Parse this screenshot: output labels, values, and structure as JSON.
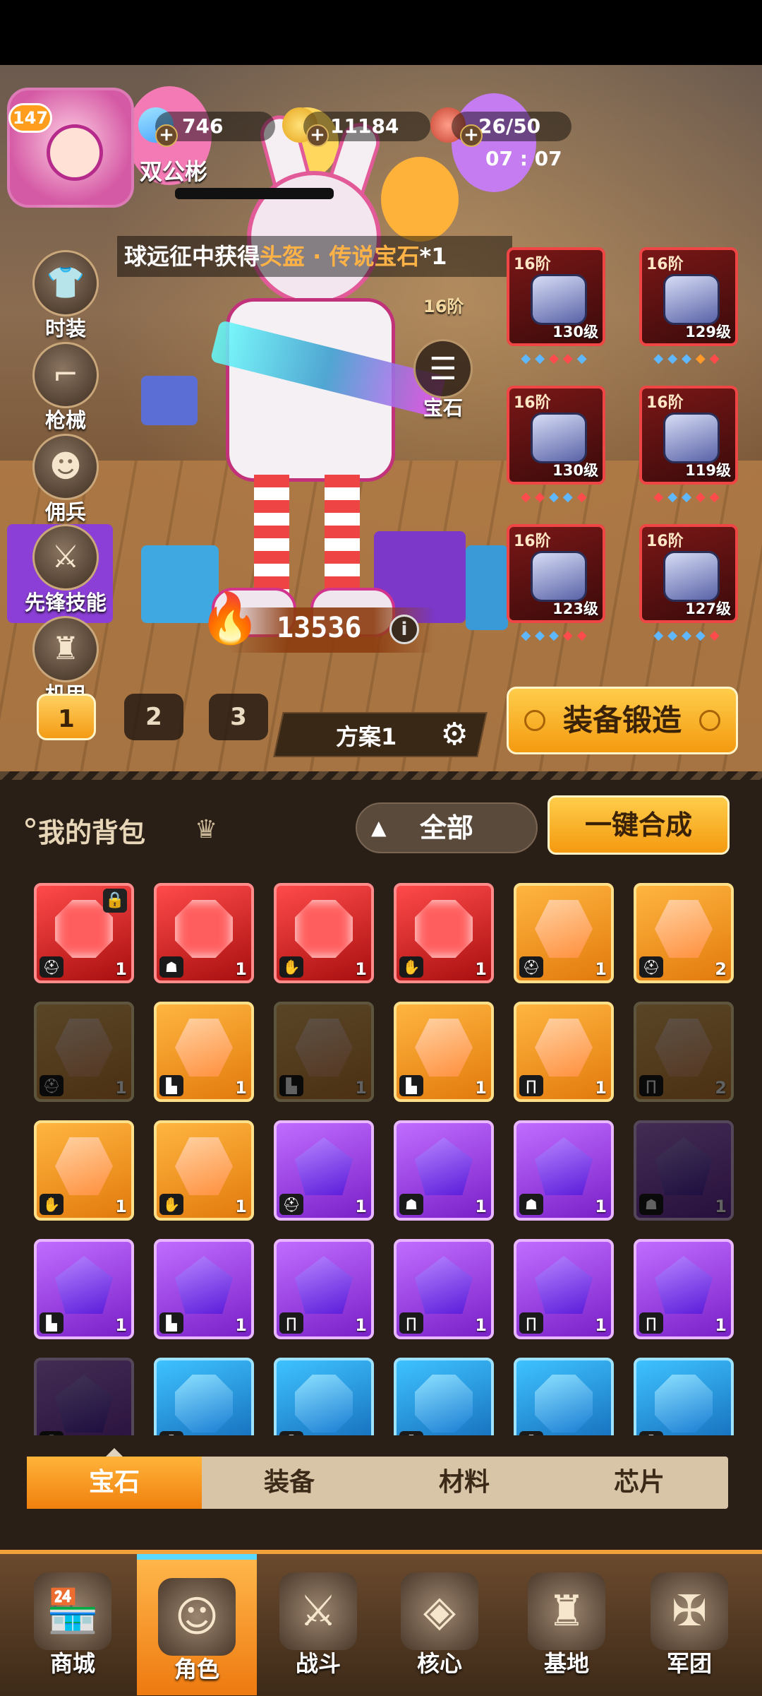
{
  "player": {
    "level": "147",
    "name": "双公彬"
  },
  "resources": {
    "gems": "746",
    "coins": "11184",
    "stamina": "26/50",
    "timer": "07 : 07"
  },
  "ticker": {
    "prefix": "球远征中获得",
    "highlight": "头盔 · 传说宝石",
    "suffix": "*1"
  },
  "side_menu": [
    {
      "label": "时装",
      "icon": "outfit-icon"
    },
    {
      "label": "枪械",
      "icon": "gun-icon"
    },
    {
      "label": "佣兵",
      "icon": "mercenary-icon"
    },
    {
      "label": "先锋技能",
      "icon": "skill-icon"
    },
    {
      "label": "机甲",
      "icon": "mech-icon"
    }
  ],
  "gem_button": {
    "label": "宝石",
    "tier": "16阶"
  },
  "equipment": [
    {
      "tier": "16阶",
      "level": "130级",
      "slot": "helmet"
    },
    {
      "tier": "16阶",
      "level": "129级",
      "slot": "gloves"
    },
    {
      "tier": "16阶",
      "level": "130级",
      "slot": "armor"
    },
    {
      "tier": "16阶",
      "level": "119级",
      "slot": "pants"
    },
    {
      "tier": "16阶",
      "level": "123级",
      "slot": "boots"
    },
    {
      "tier": "16阶",
      "level": "127级",
      "slot": "gauntlet"
    }
  ],
  "power": {
    "value": "13536",
    "info": "i"
  },
  "loadouts": [
    "1",
    "2",
    "3"
  ],
  "plan": {
    "label": "方案1"
  },
  "forge_button": "装备锻造",
  "backpack": {
    "title": "我的背包",
    "filter": "全部",
    "merge_button": "一键合成"
  },
  "gems_grid": [
    {
      "color": "red",
      "slot": "helmet",
      "count": "1",
      "locked": true,
      "dim": false
    },
    {
      "color": "red",
      "slot": "armor",
      "count": "1",
      "dim": false
    },
    {
      "color": "red",
      "slot": "gloves",
      "count": "1",
      "dim": false
    },
    {
      "color": "red",
      "slot": "gloves",
      "count": "1",
      "dim": false
    },
    {
      "color": "orange",
      "slot": "helmet",
      "count": "1",
      "dim": false
    },
    {
      "color": "orange",
      "slot": "helmet",
      "count": "2",
      "dim": false
    },
    {
      "color": "orange",
      "slot": "helmet",
      "count": "1",
      "dim": true
    },
    {
      "color": "orange",
      "slot": "boots",
      "count": "1",
      "dim": false
    },
    {
      "color": "orange",
      "slot": "boots",
      "count": "1",
      "dim": true
    },
    {
      "color": "orange",
      "slot": "boots",
      "count": "1",
      "dim": false
    },
    {
      "color": "orange",
      "slot": "pants",
      "count": "1",
      "dim": false
    },
    {
      "color": "orange",
      "slot": "pants",
      "count": "2",
      "dim": true
    },
    {
      "color": "orange",
      "slot": "gloves",
      "count": "1",
      "dim": false
    },
    {
      "color": "orange",
      "slot": "gloves",
      "count": "1",
      "dim": false
    },
    {
      "color": "purple",
      "slot": "helmet",
      "count": "1",
      "dim": false
    },
    {
      "color": "purple",
      "slot": "armor",
      "count": "1",
      "dim": false
    },
    {
      "color": "purple",
      "slot": "armor",
      "count": "1",
      "dim": false
    },
    {
      "color": "purple",
      "slot": "armor",
      "count": "1",
      "dim": true
    },
    {
      "color": "purple",
      "slot": "boots",
      "count": "1",
      "dim": false
    },
    {
      "color": "purple",
      "slot": "boots",
      "count": "1",
      "dim": false
    },
    {
      "color": "purple",
      "slot": "pants",
      "count": "1",
      "dim": false
    },
    {
      "color": "purple",
      "slot": "pants",
      "count": "1",
      "dim": false
    },
    {
      "color": "purple",
      "slot": "pants",
      "count": "1",
      "dim": false
    },
    {
      "color": "purple",
      "slot": "legs",
      "count": "1",
      "dim": false
    },
    {
      "color": "purple",
      "slot": "helmet",
      "count": "",
      "dim": true
    },
    {
      "color": "blue",
      "slot": "helmet",
      "count": "",
      "dim": false
    },
    {
      "color": "blue",
      "slot": "helmet",
      "count": "",
      "dim": false
    },
    {
      "color": "blue",
      "slot": "helmet",
      "count": "",
      "dim": false
    },
    {
      "color": "blue",
      "slot": "helmet",
      "count": "",
      "dim": false
    },
    {
      "color": "blue",
      "slot": "helmet",
      "count": "",
      "dim": false
    }
  ],
  "category_tabs": [
    "宝石",
    "装备",
    "材料",
    "芯片"
  ],
  "bottom_nav": [
    {
      "label": "商城",
      "icon": "shop-icon"
    },
    {
      "label": "角色",
      "icon": "character-icon",
      "active": true
    },
    {
      "label": "战斗",
      "icon": "battle-icon"
    },
    {
      "label": "核心",
      "icon": "core-icon"
    },
    {
      "label": "基地",
      "icon": "base-icon"
    },
    {
      "label": "军团",
      "icon": "legion-icon"
    }
  ],
  "colors": {
    "accent": "#f49a10",
    "panel": "#2a1f17",
    "equip_border": "#f04545"
  }
}
